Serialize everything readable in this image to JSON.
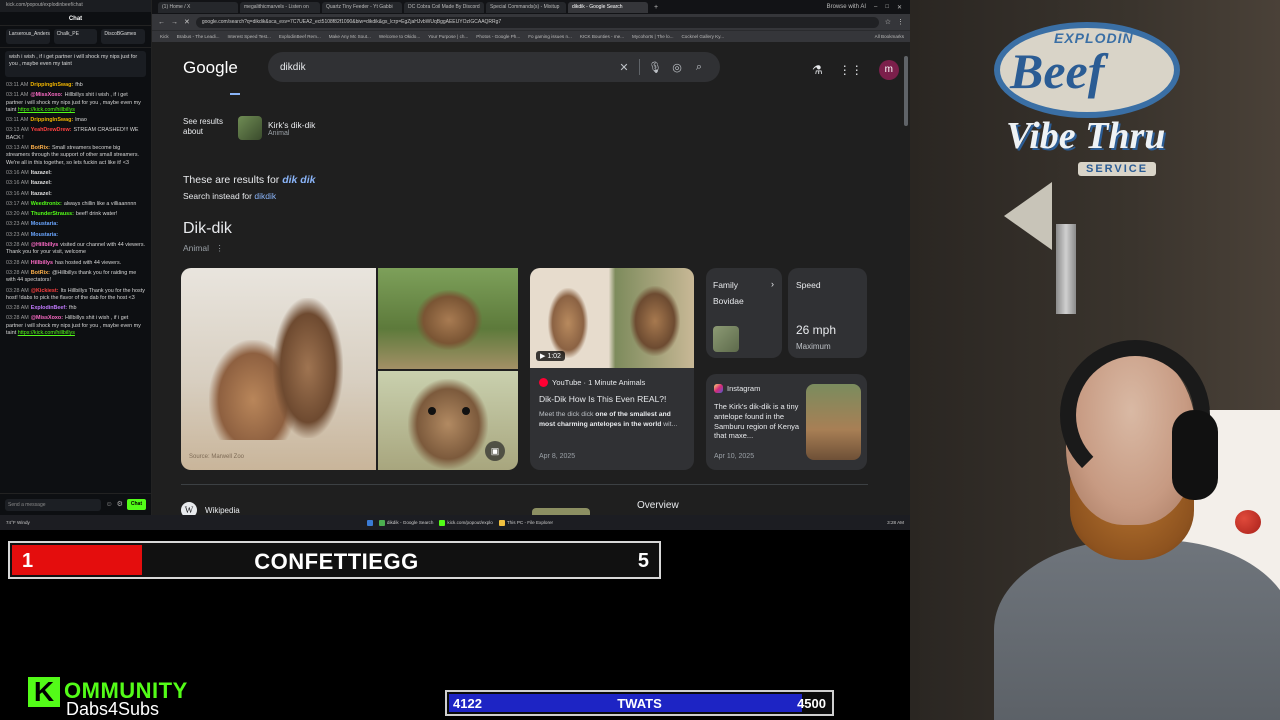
{
  "chat": {
    "url": "kick.com/popout/explodinbeef/chat",
    "title": "Chat",
    "top_users": [
      "Larserous_Anders...",
      "Chalk_PE",
      "DiscoBGames"
    ],
    "pinned": "wish i wish , if i get partner i will shock my nips just for you , maybe even my taint",
    "messages": [
      {
        "ts": "03:11 AM",
        "user": "DrippingInSwag:",
        "text": "fhb",
        "color": "#f0b400"
      },
      {
        "ts": "03:11 AM",
        "user": "@MissXoxo:",
        "text": "Hillbillys shit i wish , if i get partner i will shock my nips just for you , maybe even my taint",
        "link": "https://kick.com/hillbillys",
        "color": "#ff6cc8"
      },
      {
        "ts": "03:11 AM",
        "user": "DrippingInSwag:",
        "text": "lmao",
        "color": "#f0b400"
      },
      {
        "ts": "03:13 AM",
        "user": "YeahDrewDrew:",
        "text": "STREAM CRASHED!!! WE BACK !",
        "color": "#ff4040"
      },
      {
        "ts": "03:13 AM",
        "user": "BotRix:",
        "text": "Small streamers become big streamers through the support of other small streamers. We're all in this together, so lets fuckin act like it! <3",
        "color": "#ffb14a"
      },
      {
        "ts": "03:16 AM",
        "user": "Itazazel:",
        "text": "",
        "color": "#dddddd"
      },
      {
        "ts": "03:16 AM",
        "user": "Itazazel:",
        "text": "",
        "color": "#dddddd"
      },
      {
        "ts": "03:16 AM",
        "user": "Itazazel:",
        "text": "",
        "color": "#dddddd"
      },
      {
        "ts": "03:17 AM",
        "user": "Weedtronix:",
        "text": "always chillin like a villiaannnn",
        "color": "#53fc18"
      },
      {
        "ts": "03:20 AM",
        "user": "ThunderStrauss:",
        "text": "beef! drink water!",
        "color": "#53fc18"
      },
      {
        "ts": "03:23 AM",
        "user": "Moustaria:",
        "text": "",
        "color": "#6aa6ff"
      },
      {
        "ts": "03:23 AM",
        "user": "Moustaria:",
        "text": "",
        "color": "#6aa6ff"
      },
      {
        "ts": "03:28 AM",
        "user": "@Hillbillys",
        "text": "visited our channel with 44 viewers. Thank you for your visit, welcome",
        "color": "#ff6cc8"
      },
      {
        "ts": "03:28 AM",
        "user": "Hillbillys",
        "text": "has hosted with 44 viewers.",
        "color": "#ff6cc8"
      },
      {
        "ts": "03:28 AM",
        "user": "BotRix:",
        "text": "@Hillbillys thank you for raiding me with 44 spectators!",
        "color": "#ffb14a"
      },
      {
        "ts": "03:28 AM",
        "user": "@Kickiest:",
        "text": "Its Hillbillys Thank you for the hosty host! !dabs to pick the flavor of the dab for the host <3",
        "color": "#ff4040"
      },
      {
        "ts": "03:28 AM",
        "user": "ExplodinBeef:",
        "text": "fhb",
        "color": "#c27bff"
      },
      {
        "ts": "03:28 AM",
        "user": "@MissXoxo:",
        "text": "Hillbillys shit i wish , if i get partner i will shock my nips just for you , maybe even my taint",
        "link": "https://kick.com/hillbillys",
        "color": "#ff6cc8"
      }
    ],
    "send_placeholder": "Send a message",
    "send_label": "Chat"
  },
  "browser": {
    "tabs": [
      "(1) Home / X",
      "megalithicmarvels - Listen on",
      "Quartz Tiny Feeder - Yt Gabbi",
      "DC Cobra Coil Made By Discord",
      "Special Commands(s) - Mixitup",
      "dikdik - Google Search",
      "Browse with AI"
    ],
    "active_tab_index": 5,
    "url": "google.com/search?q=dikdik&sca_esv=7C7UEA2_ect5108f82f1090&biw=dikdik&gs_lcrp=EgZjaHJvbWUqBggAEEUYOzIGCAAQRRg7",
    "bookmarks": [
      "Kick",
      "Brabus - The Leadi...",
      "Interest Speed Test...",
      "ExplodinBeef Rem...",
      "Make Any Mc Sout...",
      "Welcome to Okido...",
      "Your Purpose | ch...",
      "Photos - Google Ph...",
      "Fo gaming issues n...",
      "KICK Bounties - me...",
      "Mycohorts | The lo...",
      "Cocknel Gallery Ky..."
    ],
    "bookmarks_all": "All Bookmarks"
  },
  "google": {
    "logo": "Google",
    "query": "dikdik",
    "avatar_letter": "m",
    "see_results_about": "See results about",
    "kirk_name": "Kirk's dik-dik",
    "kirk_type": "Animal",
    "results_for_prefix": "These are results for ",
    "results_for_term": "dik dik",
    "search_instead_prefix": "Search instead for ",
    "search_instead_term": "dikdik",
    "kp_title": "Dik-dik",
    "kp_subtitle": "Animal",
    "image_source": "Source: Marwell Zoo",
    "yt_duration": "1:02",
    "yt_source": "YouTube · 1 Minute Animals",
    "yt_title": "Dik-Dik How Is This Even REAL?!",
    "yt_desc_start": "Meet the dick dick ",
    "yt_desc_bold": "one of the smallest and most charming antelopes in the world",
    "yt_desc_end": " wit...",
    "yt_date": "Apr 8, 2025",
    "family_label": "Family",
    "family_value": "Bovidae",
    "speed_label": "Speed",
    "speed_value": "26 mph",
    "speed_unit": "Maximum",
    "ig_source": "Instagram",
    "ig_text": "The Kirk's dik-dik is a tiny antelope found in the Samburu region of Kenya that maxe...",
    "ig_date": "Apr 10, 2025",
    "wiki_label": "Wikipedia",
    "overview_label": "Overview"
  },
  "taskbar": {
    "weather": "74°F Windy",
    "items": [
      "dikdik - Google Search",
      "kick.com/popout/explo",
      "This PC - File Explorer"
    ],
    "tray": "3:28 AM"
  },
  "overlays": {
    "confetti_left": "1",
    "confetti_name": "CONFETTIEGG",
    "confetti_right": "5",
    "confetti_progress": 0.2,
    "twats_left": "4122",
    "twats_name": "TWATS",
    "twats_right": "4500",
    "twats_progress": 0.916,
    "kommunity_mark": "K",
    "kommunity": "OMMUNITY",
    "kommunity_sub": "Dabs4Subs"
  },
  "webcam_sign": {
    "top": "EXPLODIN",
    "main": "Beef",
    "mid": "Vibe Thru",
    "bottom": "SERVICE"
  },
  "colors": {
    "kick_green": "#53fc18",
    "confetti_red": "#e40d0d",
    "twats_blue": "#1d24c4",
    "google_link": "#8ab4f8"
  }
}
